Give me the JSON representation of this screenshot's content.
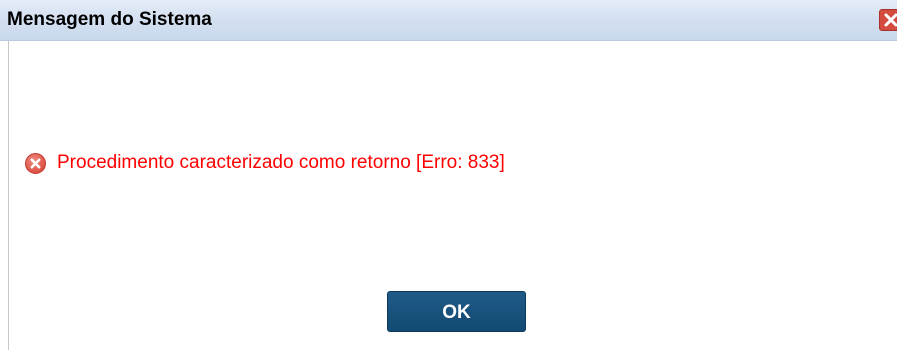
{
  "dialog": {
    "title": "Mensagem do Sistema",
    "close_icon": "close-icon"
  },
  "message": {
    "icon": "error-icon",
    "text": "Procedimento caracterizado como retorno [Erro: 833]",
    "color": "#ff0000"
  },
  "actions": {
    "ok_label": "OK"
  },
  "colors": {
    "titlebar": "#d2dff0",
    "ok_button": "#134a73",
    "close_button": "#d44c3f",
    "error_icon": "#e05a4e"
  }
}
